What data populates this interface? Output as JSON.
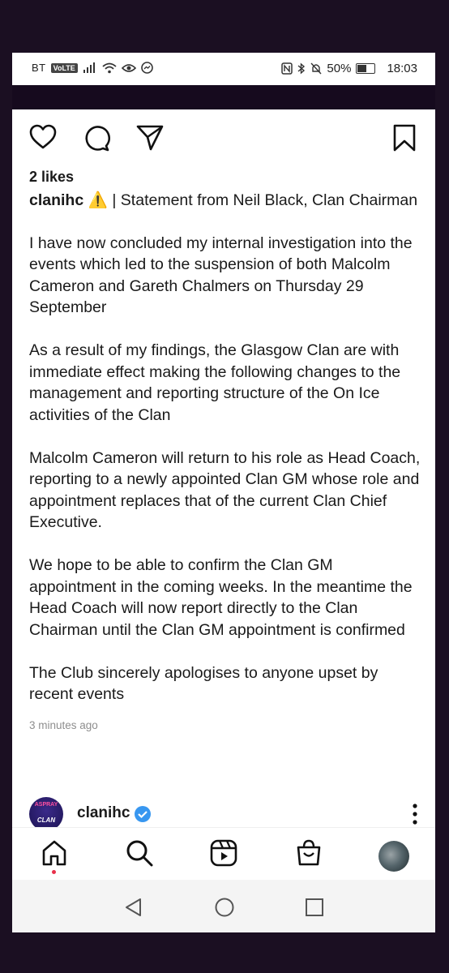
{
  "status_bar": {
    "carrier": "BT",
    "volte": "VoLTE",
    "battery": "50%",
    "time": "18:03"
  },
  "post": {
    "likes": "2 likes",
    "username": "clanihc",
    "caption_head": "⚠️ | Statement from Neil Black, Clan Chairman",
    "paragraphs": [
      "I have now concluded my internal investigation into the events which led to the suspension of both Malcolm Cameron and Gareth Chalmers on Thursday 29 September",
      "As a result of my findings, the Glasgow Clan are with immediate effect making the following changes to the management and reporting structure of the On Ice activities of the Clan",
      "Malcolm Cameron will return to his role as Head Coach, reporting to a newly appointed Clan GM whose role and appointment replaces that of the current Clan Chief Executive.",
      "We hope to be able to confirm the Clan GM appointment in the coming weeks. In the meantime the Head Coach will now report directly to the Clan Chairman until the Clan GM appointment is confirmed",
      "The Club sincerely apologises to anyone upset by recent events"
    ],
    "timestamp": "3 minutes ago"
  },
  "next_post": {
    "username": "clanihc",
    "avatar_text_top": "ASPRAY",
    "avatar_text_bottom": "CLAN"
  },
  "icons": {
    "like": "heart-icon",
    "comment": "comment-icon",
    "share": "send-icon",
    "save": "bookmark-icon",
    "home": "home-icon",
    "search": "search-icon",
    "reels": "reels-icon",
    "shop": "shop-icon",
    "profile": "profile-avatar",
    "verified": "verified-badge-icon",
    "more": "more-options-icon",
    "back": "back-triangle-icon",
    "home_sys": "home-circle-icon",
    "recents": "recents-square-icon"
  },
  "colors": {
    "background": "#1b0f22",
    "notification_dot": "#e8304a",
    "verified": "#3897f0",
    "timestamp": "#8e8e8e"
  }
}
